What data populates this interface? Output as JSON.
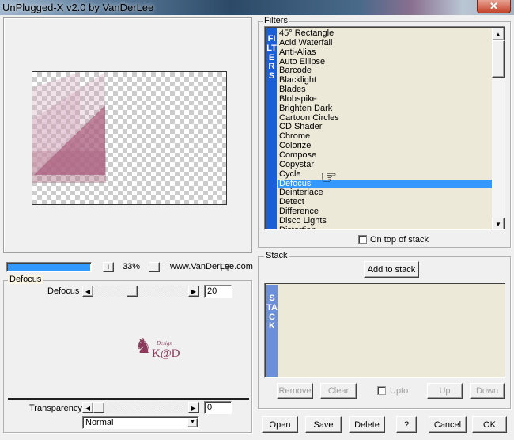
{
  "window": {
    "title": "UnPlugged-X v2.0 by VanDerLee",
    "close": "✕"
  },
  "preview": {
    "zoom": "33%",
    "zoom_in": "+",
    "zoom_out": "−",
    "website": "www.VanDerLee.com",
    "progress": 1.0,
    "accent": "#3399ff"
  },
  "filter_params": {
    "group_label": "Defocus",
    "param_label": "Defocus",
    "param_value": "20",
    "transparency_label": "Transparency",
    "transparency_value": "0",
    "blend_mode": "Normal",
    "logo_text": "Design K@D"
  },
  "filters": {
    "group_label": "Filters",
    "sidebar_text": "FILTERS",
    "selected": "Defocus",
    "items": [
      "45° Rectangle",
      "Acid Waterfall",
      "Anti-Alias",
      "Auto Ellipse",
      "Barcode",
      "Blacklight",
      "Blades",
      "Blobspike",
      "Brighten Dark",
      "Cartoon Circles",
      "CD Shader",
      "Chrome",
      "Colorize",
      "Compose",
      "Copystar",
      "Cycle",
      "Defocus",
      "Deinterlace",
      "Detect",
      "Difference",
      "Disco Lights",
      "Distortion"
    ],
    "on_top_label": "On top of stack"
  },
  "stack": {
    "group_label": "Stack",
    "add_label": "Add to stack",
    "sidebar_text": "STACK",
    "remove": "Remove",
    "clear": "Clear",
    "upto": "Upto",
    "up": "Up",
    "down": "Down"
  },
  "footer": {
    "open": "Open",
    "save": "Save",
    "delete": "Delete",
    "help": "?",
    "cancel": "Cancel",
    "ok": "OK"
  }
}
